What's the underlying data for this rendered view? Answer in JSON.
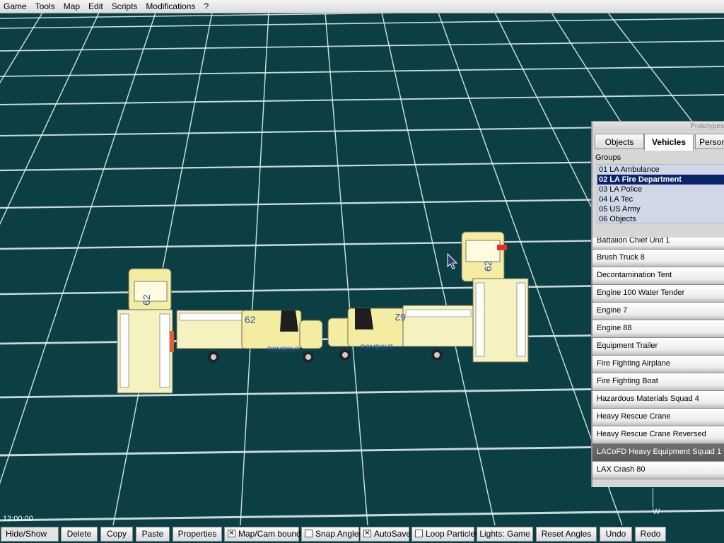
{
  "menu": [
    "Game",
    "Tools",
    "Map",
    "Edit",
    "Scripts",
    "Modifications",
    "?"
  ],
  "prototypes": {
    "title": "Prototypes",
    "tabs": [
      "Objects",
      "Vehicles",
      "Person"
    ],
    "active_tab": "Vehicles",
    "groups_label": "Groups",
    "groups": [
      "01 LA Ambulance",
      "02 LA Fire Department",
      "03 LA Police",
      "04 LA Tec",
      "05 US Army",
      "06 Objects"
    ],
    "selected_group": "02 LA Fire Department",
    "vehicles": [
      "Battalion Chief Unit 1",
      "Brush Truck 8",
      "Decontamination Tent",
      "Engine 100 Water Tender",
      "Engine 7",
      "Engine 88",
      "Equipment Trailer",
      "Fire Fighting Airplane",
      "Fire Fighting Boat",
      "Hazardous Materials Squad 4",
      "Heavy Rescue Crane",
      "Heavy Rescue Crane Reversed",
      "LACoFD Heavy Equipment Squad 1",
      "LAX Crash 80"
    ],
    "highlighted_vehicle": "LACoFD Heavy Equipment Squad 1"
  },
  "time": "12:00:00",
  "compass": "W",
  "vehicle_text": {
    "unit": "62",
    "brand": "ROMBOUT"
  },
  "toolbar": {
    "hide_show": "Hide/Show",
    "delete": "Delete",
    "copy": "Copy",
    "paste": "Paste",
    "properties": "Properties",
    "map_cam_bounds": "Map/Cam bounds",
    "map_cam_bounds_checked": true,
    "snap_angles": "Snap Angles",
    "snap_angles_checked": false,
    "autosave": "AutoSave",
    "autosave_checked": true,
    "loop_particles": "Loop Particles",
    "loop_particles_checked": false,
    "lights": "Lights: Game",
    "reset_angles": "Reset Angles",
    "undo": "Undo",
    "redo": "Redo"
  },
  "colors": {
    "ground": "#0b3f44",
    "grid": "#e8f4f4",
    "vehicle_body": "#f4eca0",
    "vehicle_white": "#f6f6f2",
    "selection": "#0a246a"
  }
}
